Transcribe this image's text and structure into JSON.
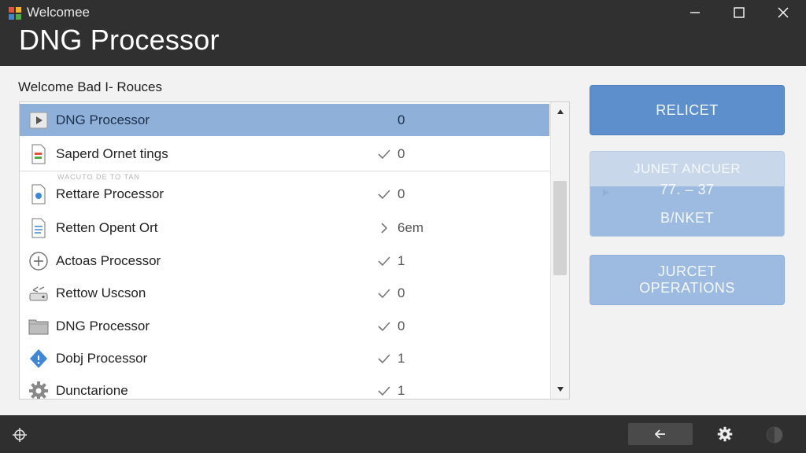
{
  "window": {
    "title": "Welcomee",
    "heading": "DNG Processor",
    "controls": [
      "minimize",
      "maximize",
      "close"
    ]
  },
  "list": {
    "title": "Welcome Bad I- Rouces",
    "faded_subtext": "WACUTO DE TO TAN",
    "rows": [
      {
        "label": "DNG Processor",
        "icon": "play-icon",
        "status": "",
        "value": "0",
        "selected": true
      },
      {
        "label": "Saperd Ornet tings",
        "icon": "document-colored-icon",
        "status": "check",
        "value": "0",
        "selected": false
      },
      {
        "label": "Rettare Processor",
        "icon": "document-blue-icon",
        "status": "check",
        "value": "0",
        "selected": false
      },
      {
        "label": "Retten Opent Ort",
        "icon": "document-lines-icon",
        "status": "chevron",
        "value": "6em",
        "selected": false
      },
      {
        "label": "Actoas Processor",
        "icon": "plus-circle-icon",
        "status": "check",
        "value": "1",
        "selected": false
      },
      {
        "label": "Rettow Uscson",
        "icon": "sync-drive-icon",
        "status": "check",
        "value": "0",
        "selected": false
      },
      {
        "label": "DNG Processor",
        "icon": "folder-icon",
        "status": "check",
        "value": "0",
        "selected": false
      },
      {
        "label": "Dobj Processor",
        "icon": "shield-info-icon",
        "status": "check",
        "value": "1",
        "selected": false
      },
      {
        "label": "Dunctarione",
        "icon": "gear-icon",
        "status": "check",
        "value": "1",
        "selected": false
      }
    ]
  },
  "actions": {
    "reject_label": "RELICET",
    "stack_line1": "JUNET ANCUER",
    "stack_line2": "77. – 37",
    "stack_line3": "B/NKET",
    "ops_line1": "JURCET",
    "ops_line2": "OPERATIONS"
  },
  "colors": {
    "titlebar": "#303030",
    "selected_row": "#8fb1d9",
    "primary_button": "#5c8fcb",
    "secondary_button": "#9dbbe0",
    "bottombar": "#2f2f2f"
  },
  "bottom": {
    "icons": [
      "move-icon",
      "back-arrow-icon",
      "gear-icon",
      "profile-icon"
    ]
  }
}
